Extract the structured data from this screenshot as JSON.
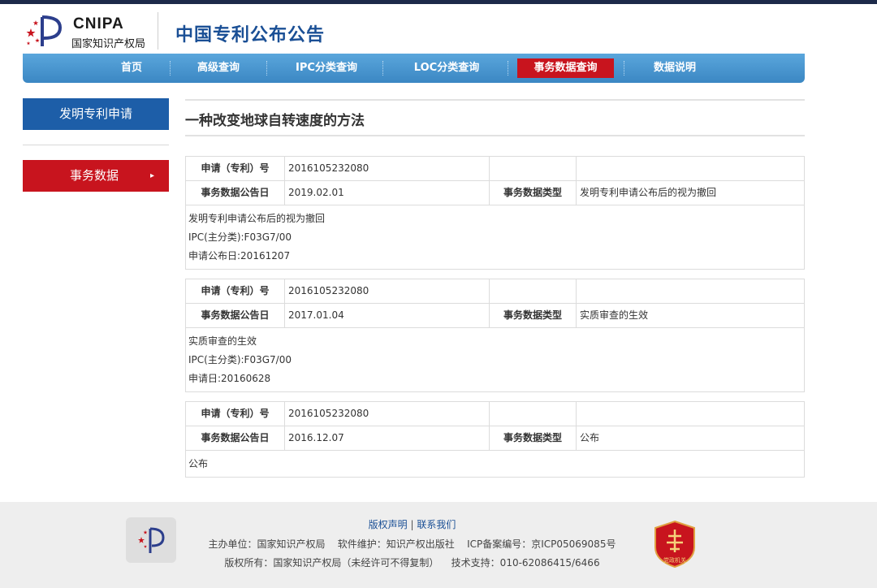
{
  "header": {
    "logo_en": "CNIPA",
    "logo_cn": "国家知识产权局",
    "title": "中国专利公布公告"
  },
  "nav": {
    "items": [
      {
        "label": "首页"
      },
      {
        "label": "高级查询"
      },
      {
        "label": "IPC分类查询"
      },
      {
        "label": "LOC分类查询"
      },
      {
        "label": "事务数据查询",
        "active": true
      },
      {
        "label": "数据说明"
      }
    ]
  },
  "sidebar": {
    "category": "发明专利申请",
    "active_item": "事务数据",
    "active_arrow": "▸"
  },
  "main": {
    "title": "一种改变地球自转速度的方法"
  },
  "labels": {
    "app_no": "申请（专利）号",
    "pub_date": "事务数据公告日",
    "data_type": "事务数据类型"
  },
  "records": [
    {
      "app_no": "2016105232080",
      "date": "2019.02.01",
      "type": "发明专利申请公布后的视为撤回",
      "details": [
        "发明专利申请公布后的视为撤回",
        "IPC(主分类):F03G7/00",
        "申请公布日:20161207"
      ]
    },
    {
      "app_no": "2016105232080",
      "date": "2017.01.04",
      "type": "实质审查的生效",
      "details": [
        "实质审查的生效",
        "IPC(主分类):F03G7/00",
        "申请日:20160628"
      ]
    },
    {
      "app_no": "2016105232080",
      "date": "2016.12.07",
      "type": "公布",
      "details": [
        "公布"
      ]
    }
  ],
  "footer": {
    "copyright_link": "版权声明",
    "separator": "|",
    "contact_link": "联系我们",
    "line1": "主办单位：国家知识产权局    软件维护：知识产权出版社    ICP备案编号：京ICP05069085号",
    "line2": "版权所有：国家知识产权局（未经许可不得复制）    技术支持：010-62086415/6466",
    "badge_text": "党政机关"
  },
  "colors": {
    "nav_blue": "#4a97d0",
    "accent_red": "#c8141e",
    "sidebar_blue": "#1d5ea8",
    "title_blue": "#1a4f95"
  }
}
